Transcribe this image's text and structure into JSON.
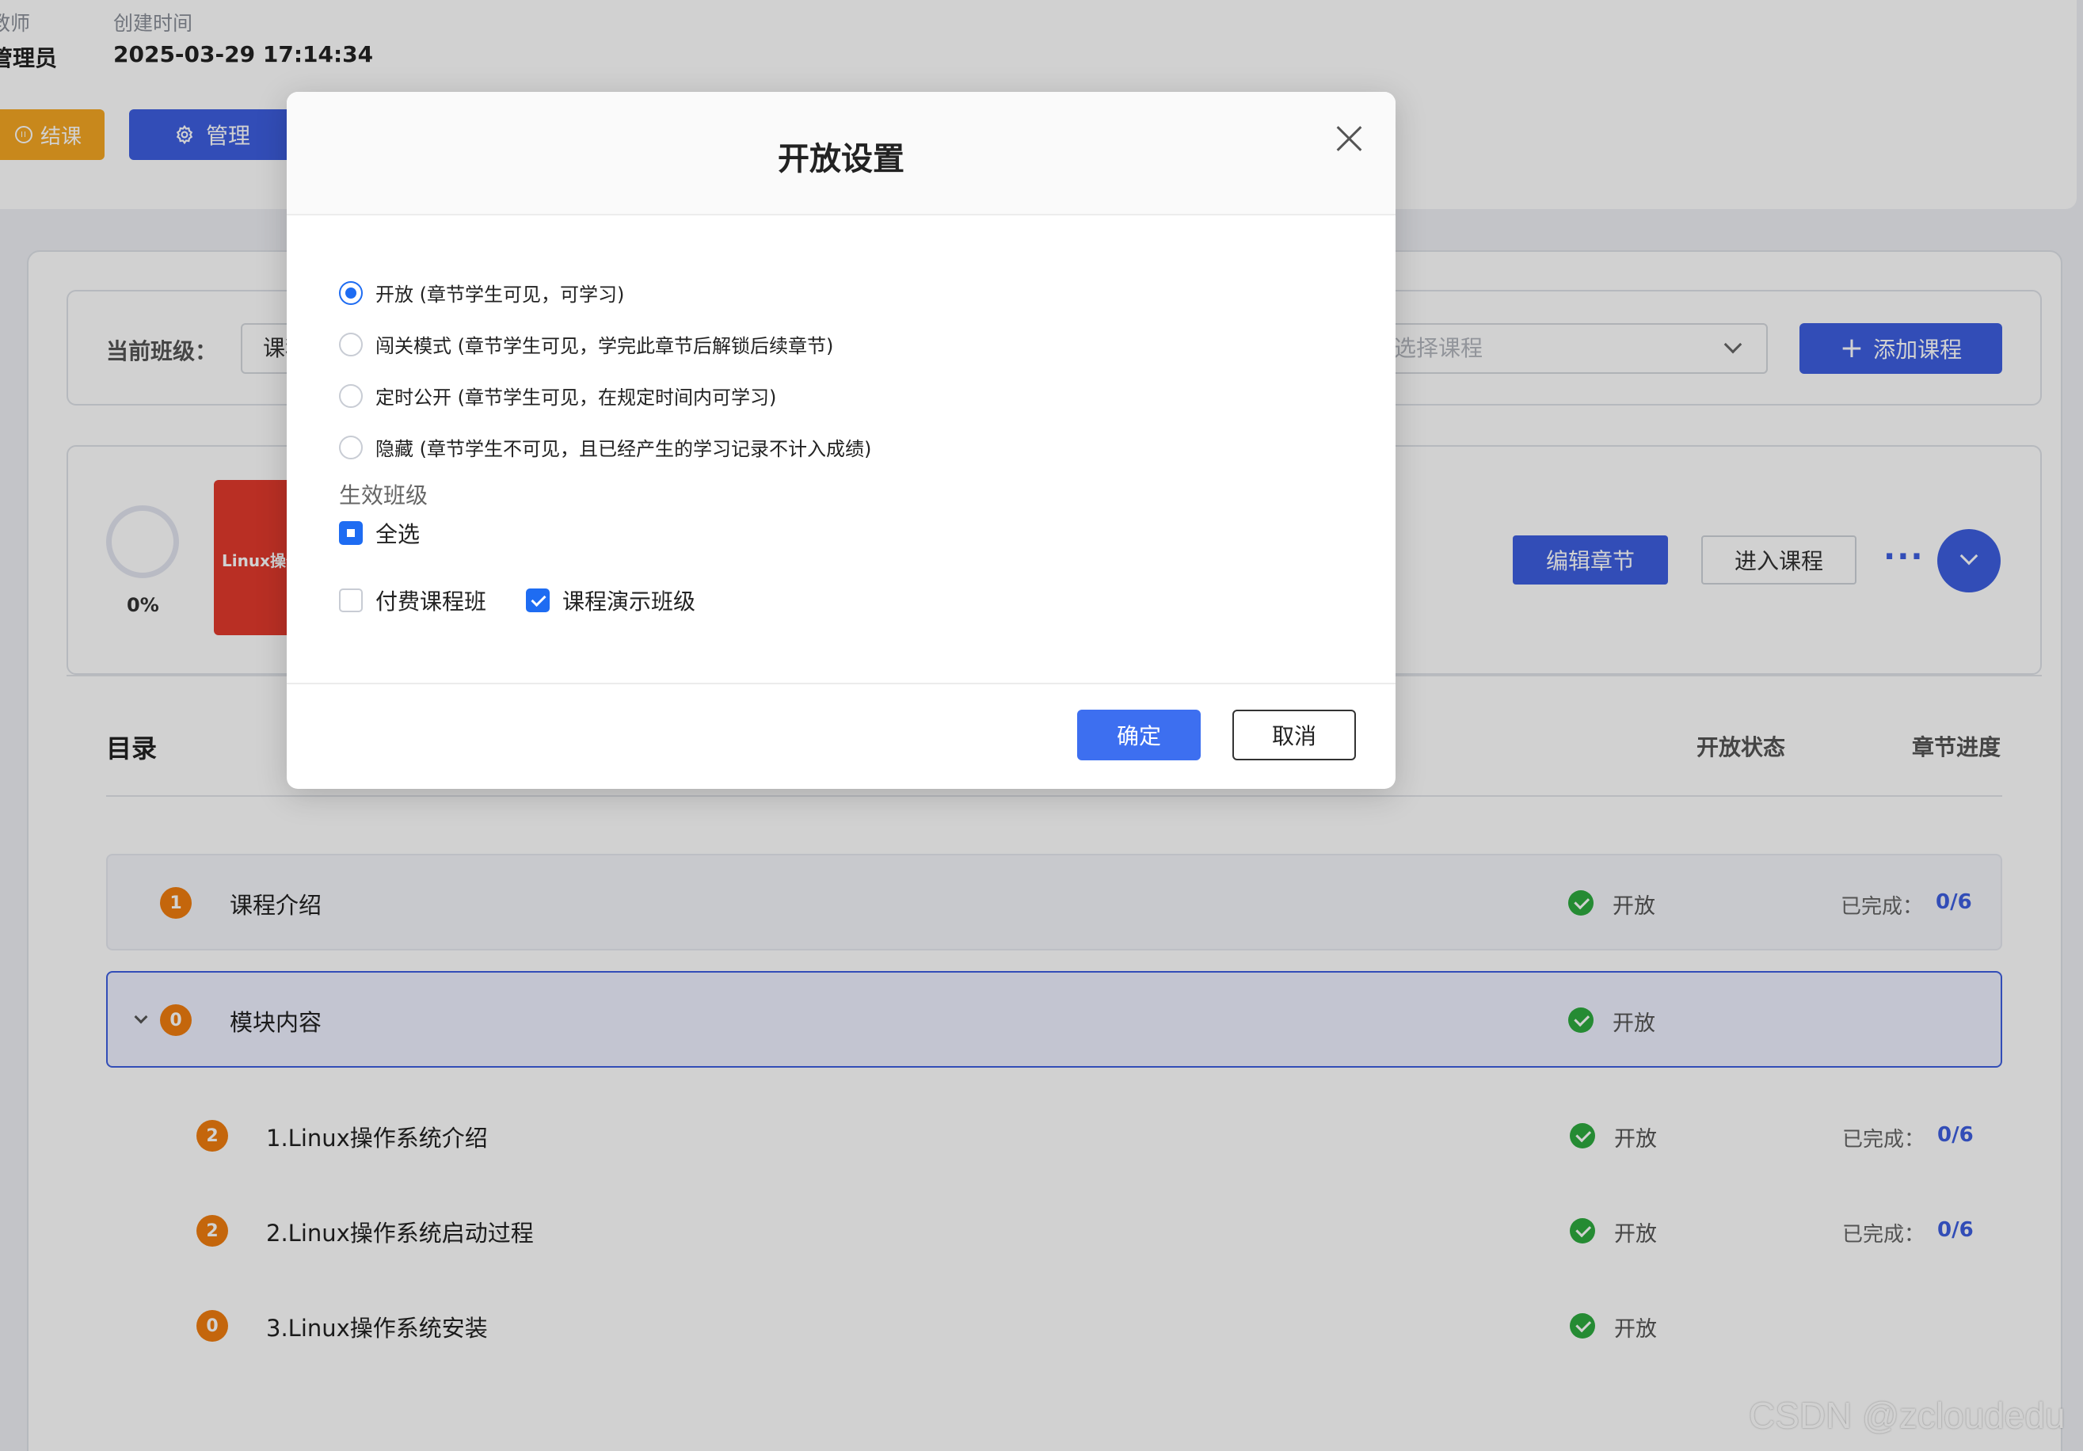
{
  "header": {
    "teacher_label": "教师",
    "teacher_value": "管理员",
    "created_label": "创建时间",
    "created_value": "2025-03-29 17:14:34",
    "end_button": "结课",
    "manage_button": "管理"
  },
  "class_bar": {
    "label": "当前班级：",
    "class_select_value": "课程演示班级",
    "course_select_placeholder": "选择课程",
    "add_course_button": "添加课程"
  },
  "course_card": {
    "progress_text": "0%",
    "cover_text": "Linux操作系统",
    "edit_button": "编辑章节",
    "enter_button": "进入课程",
    "more_button": "···"
  },
  "toc": {
    "title": "目录",
    "col_status": "开放状态",
    "col_progress": "章节进度",
    "rows": [
      {
        "badge": "1",
        "name": "课程介绍",
        "status": "开放",
        "done_label": "已完成：",
        "done_value": "0/6"
      },
      {
        "badge": "0",
        "name": "模块内容",
        "status": "开放"
      },
      {
        "badge": "2",
        "name": "1.Linux操作系统介绍",
        "status": "开放",
        "done_label": "已完成：",
        "done_value": "0/6"
      },
      {
        "badge": "2",
        "name": "2.Linux操作系统启动过程",
        "status": "开放",
        "done_label": "已完成：",
        "done_value": "0/6"
      },
      {
        "badge": "0",
        "name": "3.Linux操作系统安装",
        "status": "开放"
      }
    ]
  },
  "modal": {
    "title": "开放设置",
    "options": [
      {
        "label": "开放 (章节学生可见，可学习)",
        "selected": true
      },
      {
        "label": "闯关模式 (章节学生可见，学完此章节后解锁后续章节)",
        "selected": false
      },
      {
        "label": "定时公开 (章节学生可见，在规定时间内可学习)",
        "selected": false
      },
      {
        "label": "隐藏 (章节学生不可见，且已经产生的学习记录不计入成绩)",
        "selected": false
      }
    ],
    "section_label": "生效班级",
    "select_all": "全选",
    "classes": [
      {
        "label": "付费课程班",
        "checked": false
      },
      {
        "label": "课程演示班级",
        "checked": true
      }
    ],
    "ok_button": "确定",
    "cancel_button": "取消"
  },
  "watermark": "CSDN @zcloudedu",
  "colors": {
    "primary": "#3d5fe0",
    "accent_orange": "#ef7d0f",
    "success": "#2eaa3f",
    "radio_blue": "#1e6cf2"
  }
}
